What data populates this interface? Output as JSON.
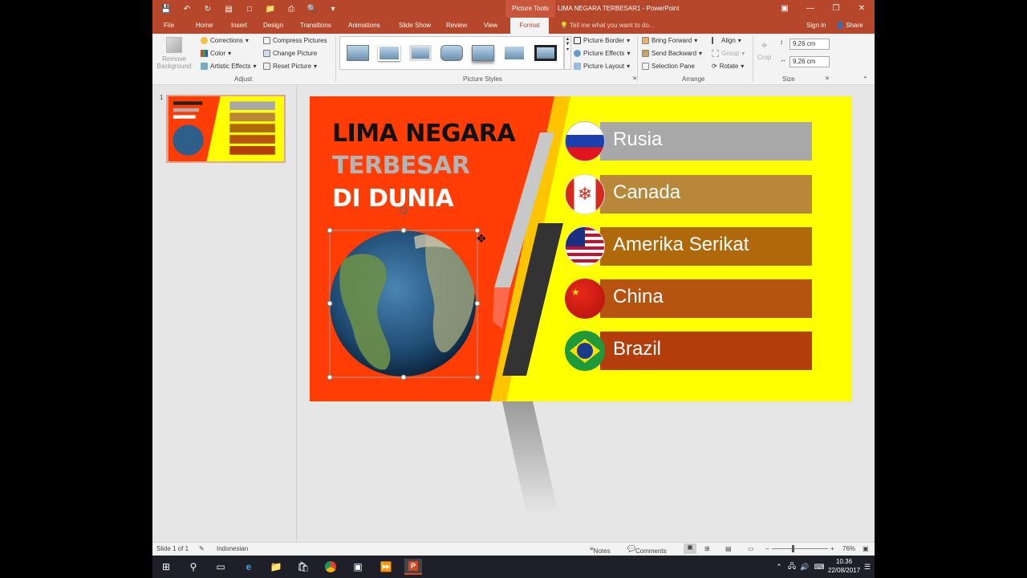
{
  "titlebar": {
    "contextual_tab": "Picture Tools",
    "doc_title": "LIMA NEGARA TERBESAR1 - PowerPoint"
  },
  "tabs": {
    "file": "File",
    "home": "Home",
    "insert": "Insert",
    "design": "Design",
    "transitions": "Transitions",
    "animations": "Animations",
    "slideshow": "Slide Show",
    "review": "Review",
    "view": "View",
    "format": "Format",
    "tellme": "Tell me what you want to do...",
    "signin": "Sign in",
    "share": "Share"
  },
  "ribbon": {
    "remove_bg_1": "Remove",
    "remove_bg_2": "Background",
    "corrections": "Corrections",
    "color": "Color",
    "artistic": "Artistic Effects",
    "compress": "Compress Pictures",
    "change": "Change Picture",
    "reset": "Reset Picture",
    "adjust_label": "Adjust",
    "styles_label": "Picture Styles",
    "border": "Picture Border",
    "effects": "Picture Effects",
    "layout": "Picture Layout",
    "bring_forward": "Bring Forward",
    "send_backward": "Send Backward",
    "selection_pane": "Selection Pane",
    "align": "Align",
    "group": "Group",
    "rotate": "Rotate",
    "arrange_label": "Arrange",
    "crop": "Crop",
    "height": "9,26 cm",
    "width": "9,26 cm",
    "size_label": "Size"
  },
  "thumb": {
    "number": "1"
  },
  "slide": {
    "title_line1": "LIMA NEGARA",
    "title_line2": "TERBESAR",
    "title_line3": "DI DUNIA",
    "countries": [
      "Rusia",
      "Canada",
      "Amerika Serikat",
      "China",
      "Brazil"
    ],
    "bar_colors": [
      "#a8a8a8",
      "#b8873a",
      "#b0690a",
      "#b65310",
      "#b43d0c"
    ],
    "bg_left": "#ff3d05",
    "bg_right": "#ffff00"
  },
  "status": {
    "slide_of": "Slide 1 of 1",
    "language": "Indonesian",
    "notes": "Notes",
    "comments": "Comments",
    "zoom": "76%"
  },
  "taskbar": {
    "time": "10.36",
    "date": "22/08/2017"
  }
}
